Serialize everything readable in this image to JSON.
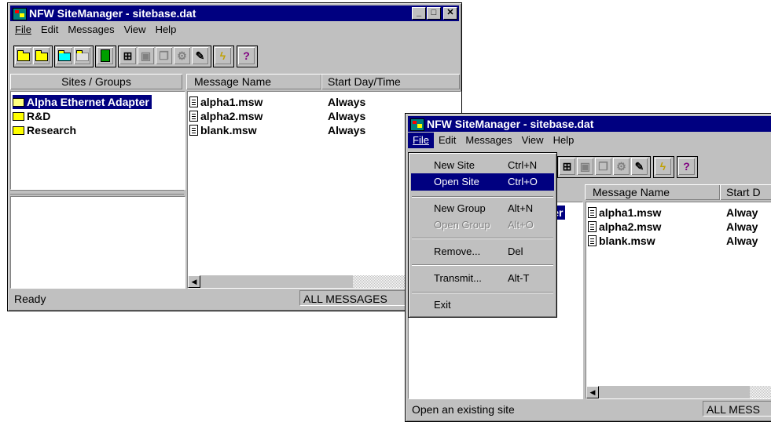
{
  "window1": {
    "title": "NFW SiteManager - sitebase.dat",
    "menu": [
      "File",
      "Edit",
      "Messages",
      "View",
      "Help"
    ],
    "sites_header": "Sites / Groups",
    "msg_header": "Message Name",
    "time_header": "Start Day/Time",
    "sites": [
      {
        "label": "Alpha Ethernet Adapter",
        "selected": true
      },
      {
        "label": "R&D"
      },
      {
        "label": "Research"
      }
    ],
    "messages": [
      {
        "name": "alpha1.msw",
        "time": "Always"
      },
      {
        "name": "alpha2.msw",
        "time": "Always"
      },
      {
        "name": "blank.msw",
        "time": "Always"
      }
    ],
    "status": "Ready",
    "status_right": "ALL MESSAGES"
  },
  "window2": {
    "title": "NFW SiteManager - sitebase.dat",
    "menu": [
      "File",
      "Edit",
      "Messages",
      "View",
      "Help"
    ],
    "msg_header": "Message Name",
    "time_header": "Start D",
    "site_partial": "pter",
    "messages": [
      {
        "name": "alpha1.msw",
        "time": "Alway"
      },
      {
        "name": "alpha2.msw",
        "time": "Alway"
      },
      {
        "name": "blank.msw",
        "time": "Alway"
      }
    ],
    "status": "Open an existing site",
    "status_right": "ALL MESS"
  },
  "file_menu": {
    "items": [
      {
        "label": "New Site",
        "accel": "Ctrl+N"
      },
      {
        "label": "Open Site",
        "accel": "Ctrl+O",
        "highlighted": true
      },
      {
        "label": "New Group",
        "accel": "Alt+N"
      },
      {
        "label": "Open Group",
        "accel": "Alt+O",
        "disabled": true
      },
      {
        "label": "Remove...",
        "accel": "Del"
      },
      {
        "label": "Transmit...",
        "accel": "Alt-T"
      },
      {
        "label": "Exit",
        "accel": ""
      }
    ]
  },
  "toolbar_icons": [
    "new-folder-icon",
    "open-folder-icon",
    "new-group-icon",
    "open-group-icon",
    "delete-trash-icon",
    "add-message-icon",
    "edit-message-icon",
    "copy-message-icon",
    "settings-icon",
    "pencil-icon",
    "transmit-lightning-icon",
    "help-question-icon"
  ],
  "colors": {
    "titlebar": "#000080",
    "face": "#c0c0c0",
    "selection": "#000080"
  }
}
